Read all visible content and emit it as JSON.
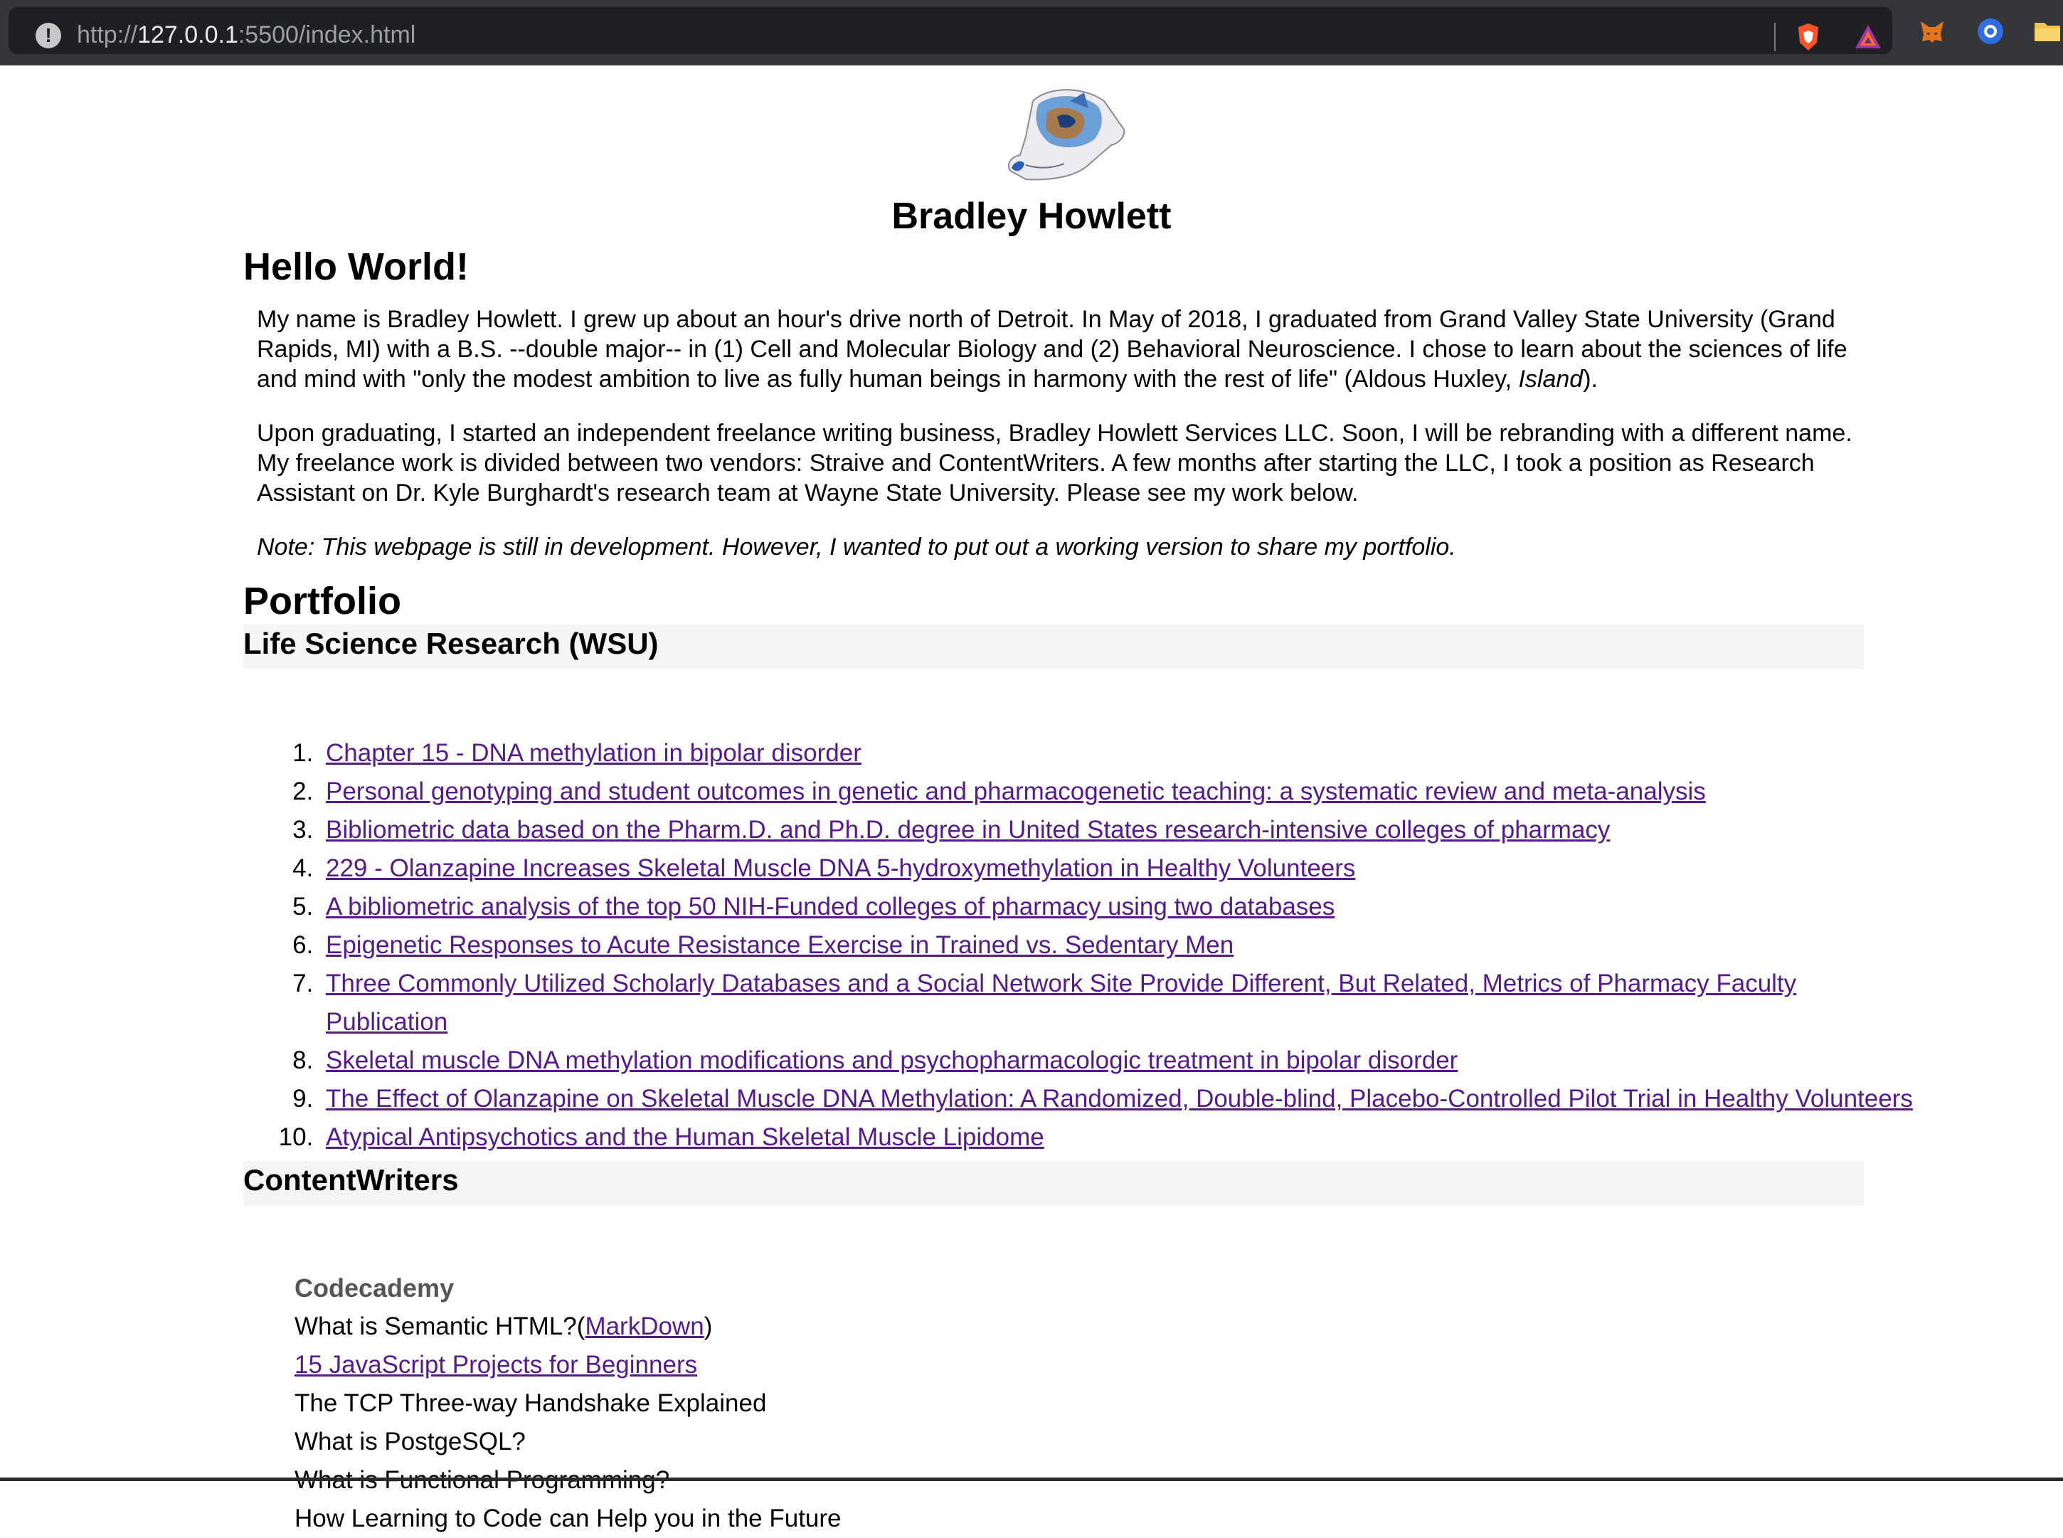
{
  "browser": {
    "url_prefix": "http://",
    "url_host": "127.0.0.1",
    "url_rest": ":5500/index.html"
  },
  "header": {
    "site_name": "Bradley Howlett"
  },
  "intro": {
    "heading": "Hello World!",
    "para1_a": "My name is Bradley Howlett. I grew up about an hour's drive north of Detroit. In May of 2018, I graduated from Grand Valley State University (Grand Rapids, MI) with a B.S. --double major-- in (1) Cell and Molecular Biology and (2) Behavioral Neuroscience. I chose to learn about the sciences of life and mind with \"only the modest ambition to live as fully human beings in harmony with the rest of life\" (Aldous Huxley, ",
    "para1_em": "Island",
    "para1_b": ").",
    "para2": "Upon graduating, I started an independent freelance writing business, Bradley Howlett Services LLC. Soon, I will be rebranding with a different name. My freelance work is divided between two vendors: Straive and ContentWriters. A few months after starting the LLC, I took a position as Research Assistant on Dr. Kyle Burghardt's research team at Wayne State University. Please see my work below.",
    "note": "Note: This webpage is still in development. However, I wanted to put out a working version to share my portfolio."
  },
  "portfolio": {
    "heading": "Portfolio",
    "research_heading": "Life Science Research (WSU)",
    "research_items": [
      "Chapter 15 - DNA methylation in bipolar disorder",
      "Personal genotyping and student outcomes in genetic and pharmacogenetic teaching: a systematic review and meta-analysis",
      "Bibliometric data based on the Pharm.D. and Ph.D. degree in United States research-intensive colleges of pharmacy",
      "229 - Olanzapine Increases Skeletal Muscle DNA 5-hydroxymethylation in Healthy Volunteers",
      "A bibliometric analysis of the top 50 NIH-Funded colleges of pharmacy using two databases",
      "Epigenetic Responses to Acute Resistance Exercise in Trained vs. Sedentary Men",
      "Three Commonly Utilized Scholarly Databases and a Social Network Site Provide Different, But Related, Metrics of Pharmacy Faculty Publication",
      "Skeletal muscle DNA methylation modifications and psychopharmacologic treatment in bipolar disorder",
      "The Effect of Olanzapine on Skeletal Muscle DNA Methylation: A Randomized, Double-blind, Placebo-Controlled Pilot Trial in Healthy Volunteers",
      "Atypical Antipsychotics and the Human Skeletal Muscle Lipidome"
    ],
    "cw_heading": "ContentWriters",
    "codecademy": {
      "title": "Codecademy",
      "item1_text": "What is Semantic HTML?(",
      "item1_link": "MarkDown",
      "item1_close": ")",
      "item2_link": "15 JavaScript Projects for Beginners",
      "item3": "The TCP Three-way Handshake Explained",
      "item4": "What is PostgeSQL?",
      "item5": "What is Functional Programming?",
      "item6": "How Learning to Code can Help you in the Future"
    }
  }
}
